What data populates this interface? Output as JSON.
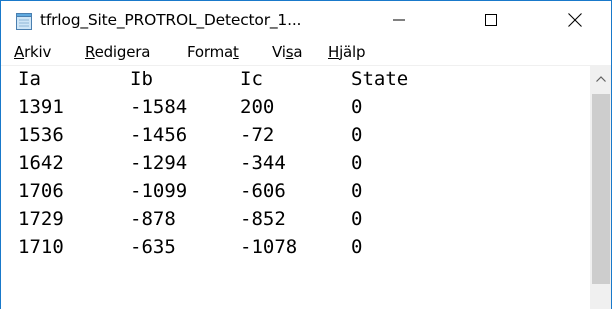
{
  "window": {
    "title": "tfrlog_Site_PROTROL_Detector_1...",
    "minimize_icon": "minimize-icon",
    "maximize_icon": "maximize-icon",
    "close_icon": "close-icon"
  },
  "menu": {
    "file": {
      "mnemonic": "A",
      "rest": "rkiv"
    },
    "edit": {
      "mnemonic": "R",
      "rest": "edigera"
    },
    "format": {
      "before": "Forma",
      "mnemonic": "t",
      "after": ""
    },
    "view": {
      "before": "Vi",
      "mnemonic": "s",
      "after": "a"
    },
    "help": {
      "mnemonic": "H",
      "rest": "jälp"
    }
  },
  "table": {
    "headers": [
      "Ia",
      "Ib",
      "Ic",
      "State"
    ],
    "rows": [
      [
        "1391",
        "-1584",
        "200",
        "0"
      ],
      [
        "1536",
        "-1456",
        "-72",
        "0"
      ],
      [
        "1642",
        "-1294",
        "-344",
        "0"
      ],
      [
        "1706",
        "-1099",
        "-606",
        "0"
      ],
      [
        "1729",
        "-878",
        "-852",
        "0"
      ],
      [
        "1710",
        "-635",
        "-1078",
        "0"
      ]
    ]
  },
  "colors": {
    "window_border": "#1979ca",
    "scrollbar_track": "#f0f0f0",
    "scrollbar_thumb": "#cdcdcd"
  }
}
